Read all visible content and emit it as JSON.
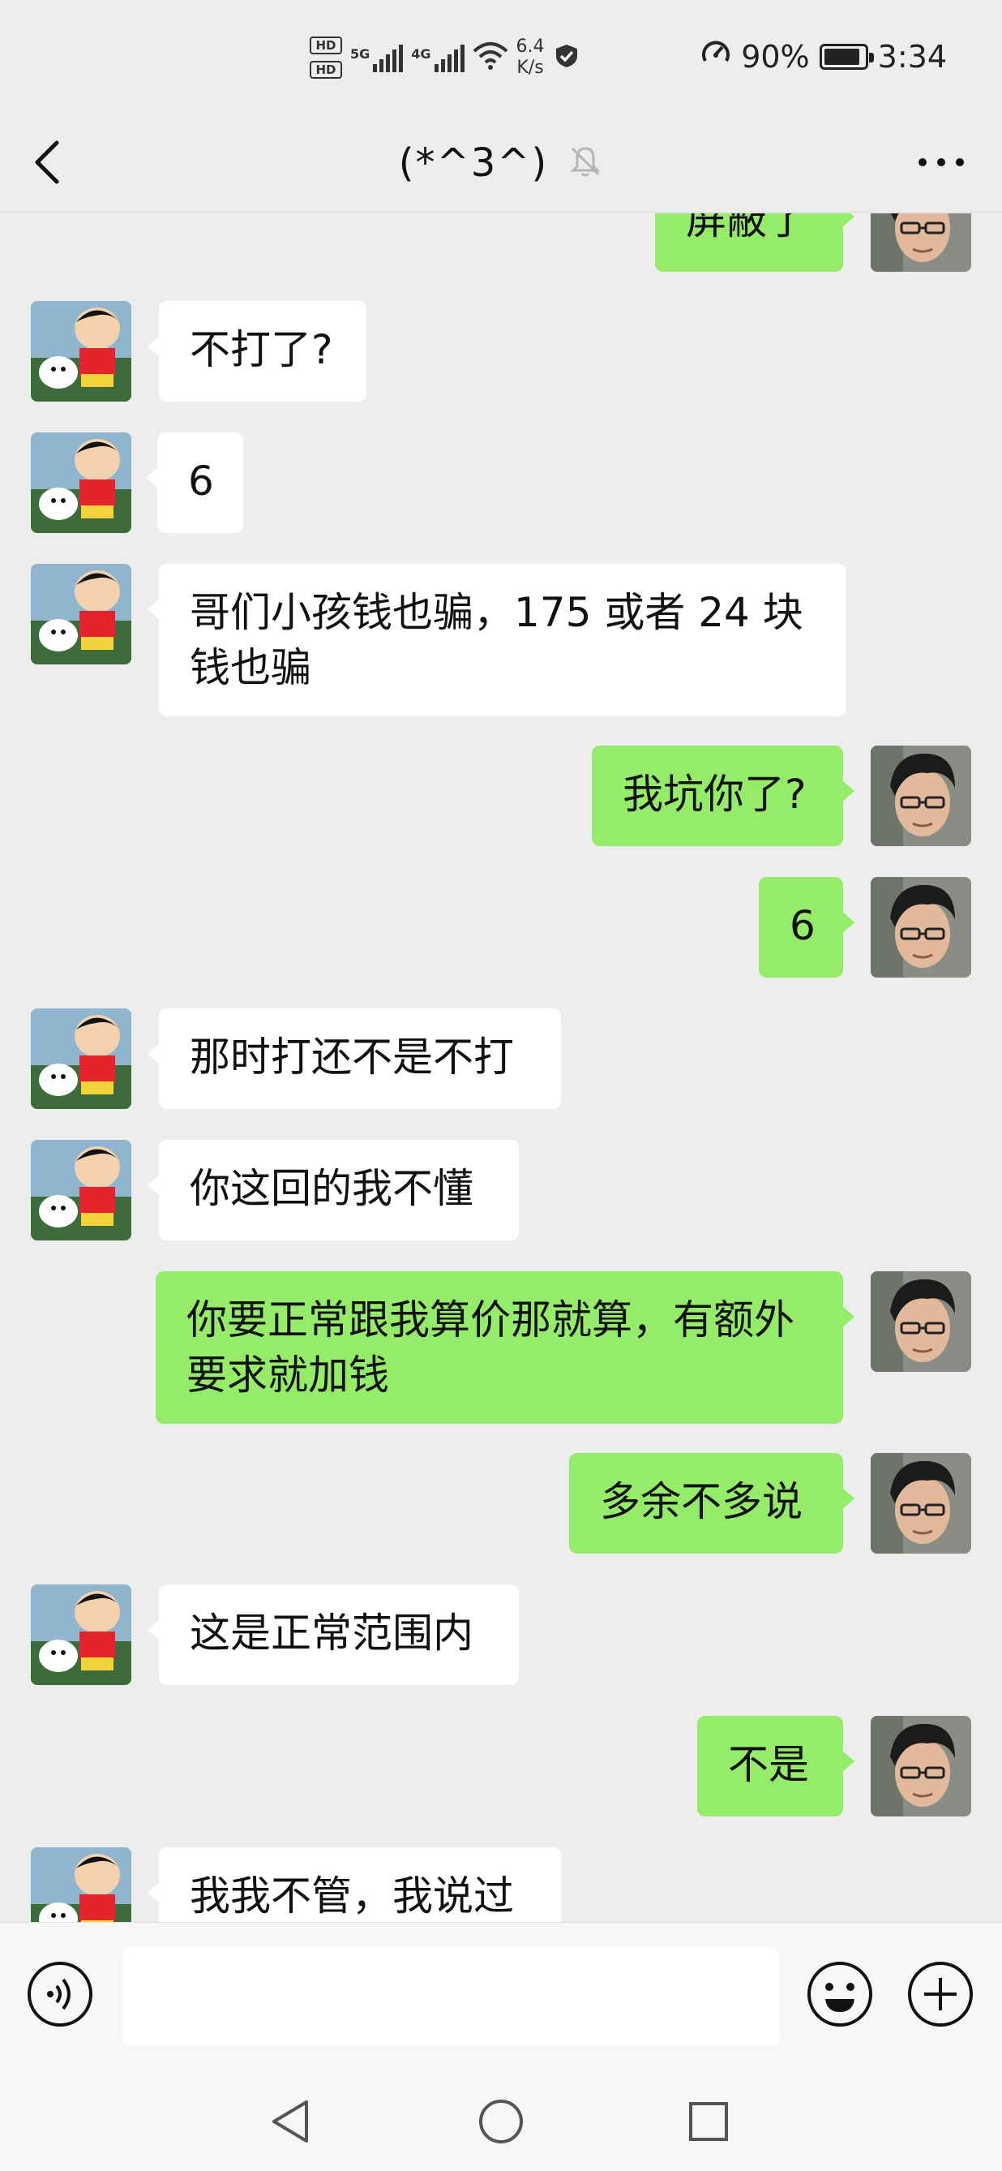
{
  "status_bar": {
    "hd1": "HD",
    "hd2": "HD",
    "net1": "5G",
    "net2": "4G",
    "speed_value": "6.4",
    "speed_unit": "K/s",
    "battery_percent": "90%",
    "battery_level": 0.9,
    "time": "3:34",
    "icons": [
      "signal-icon",
      "wifi-icon",
      "shield-check-icon",
      "data-saver-icon",
      "battery-icon"
    ]
  },
  "header": {
    "title": "(*^3^)",
    "muted_icon": "bell-off-icon",
    "back_icon": "chevron-left-icon",
    "more_icon": "more-dots-icon"
  },
  "messages": [
    {
      "side": "out",
      "text": "屏蔽了"
    },
    {
      "side": "in",
      "text": "不打了?"
    },
    {
      "side": "in",
      "text": "6"
    },
    {
      "side": "in",
      "text": "哥们小孩钱也骗，175 或者 24 块钱也骗"
    },
    {
      "side": "out",
      "text": "我坑你了?"
    },
    {
      "side": "out",
      "text": "6"
    },
    {
      "side": "in",
      "text": "那时打还不是不打"
    },
    {
      "side": "in",
      "text": "你这回的我不懂"
    },
    {
      "side": "out",
      "text": "你要正常跟我算价那就算，有额外要求就加钱"
    },
    {
      "side": "out",
      "text": "多余不多说"
    },
    {
      "side": "in",
      "text": "这是正常范围内"
    },
    {
      "side": "out",
      "text": "不是"
    },
    {
      "side": "in",
      "text": "我我不管，我说过"
    }
  ],
  "input_bar": {
    "value": "",
    "voice_icon": "voice-icon",
    "emoji_icon": "emoji-icon",
    "plus_icon": "plus-icon"
  },
  "nav_bar": {
    "icons": [
      "nav-back-icon",
      "nav-home-icon",
      "nav-recents-icon"
    ]
  },
  "colors": {
    "background": "#ededed",
    "outgoing_bubble": "#95ec69",
    "incoming_bubble": "#ffffff"
  }
}
